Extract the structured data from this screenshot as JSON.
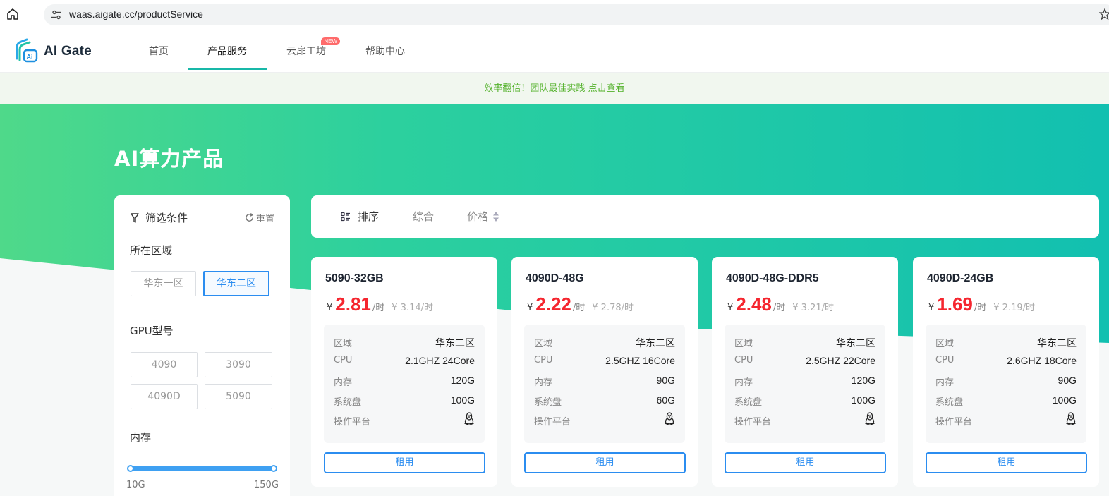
{
  "browser": {
    "url": "waas.aigate.cc/productService",
    "icons": [
      "home-icon",
      "site-settings-icon",
      "bookmark-star-icon"
    ]
  },
  "nav": {
    "logo_text": "AI Gate",
    "items": [
      {
        "label": "首页",
        "active": false
      },
      {
        "label": "产品服务",
        "active": true
      },
      {
        "label": "云扉工坊",
        "active": false,
        "badge": "NEW"
      },
      {
        "label": "帮助中心",
        "active": false
      }
    ]
  },
  "announcement": {
    "text": "效率翻倍！团队最佳实践",
    "link": "点击查看"
  },
  "hero": {
    "title": "AI算力产品"
  },
  "filter": {
    "title": "筛选条件",
    "reset": "重置",
    "region": {
      "label": "所在区域",
      "options": [
        "华东一区",
        "华东二区"
      ],
      "selected": "华东二区"
    },
    "gpu": {
      "label": "GPU型号",
      "options": [
        "4090",
        "3090",
        "4090D",
        "5090"
      ]
    },
    "memory": {
      "label": "内存",
      "min_label": "10G",
      "max_label": "150G",
      "range": [
        10,
        150
      ]
    }
  },
  "sort": {
    "label": "排序",
    "options": [
      "综合",
      "价格"
    ]
  },
  "products": [
    {
      "name": "5090-32GB",
      "currency": "¥",
      "price": "2.81",
      "unit": "/时",
      "original": "¥ 3.14/时",
      "specs": [
        {
          "k": "区域",
          "v": "华东二区"
        },
        {
          "k": "CPU",
          "v": "2.1GHZ 24Core"
        },
        {
          "k": "内存",
          "v": "120G"
        },
        {
          "k": "系统盘",
          "v": "100G"
        }
      ],
      "platform_label": "操作平台",
      "platform_icon": "linux-icon",
      "rent": "租用"
    },
    {
      "name": "4090D-48G",
      "currency": "¥",
      "price": "2.22",
      "unit": "/时",
      "original": "¥ 2.78/时",
      "specs": [
        {
          "k": "区域",
          "v": "华东二区"
        },
        {
          "k": "CPU",
          "v": "2.5GHZ 16Core"
        },
        {
          "k": "内存",
          "v": "90G"
        },
        {
          "k": "系统盘",
          "v": "60G"
        }
      ],
      "platform_label": "操作平台",
      "platform_icon": "linux-icon",
      "rent": "租用"
    },
    {
      "name": "4090D-48G-DDR5",
      "currency": "¥",
      "price": "2.48",
      "unit": "/时",
      "original": "¥ 3.21/时",
      "specs": [
        {
          "k": "区域",
          "v": "华东二区"
        },
        {
          "k": "CPU",
          "v": "2.5GHZ 22Core"
        },
        {
          "k": "内存",
          "v": "120G"
        },
        {
          "k": "系统盘",
          "v": "100G"
        }
      ],
      "platform_label": "操作平台",
      "platform_icon": "linux-icon",
      "rent": "租用"
    },
    {
      "name": "4090D-24GB",
      "currency": "¥",
      "price": "1.69",
      "unit": "/时",
      "original": "¥ 2.19/时",
      "specs": [
        {
          "k": "区域",
          "v": "华东二区"
        },
        {
          "k": "CPU",
          "v": "2.6GHZ 18Core"
        },
        {
          "k": "内存",
          "v": "90G"
        },
        {
          "k": "系统盘",
          "v": "100G"
        }
      ],
      "platform_label": "操作平台",
      "platform_icon": "linux-icon",
      "rent": "租用"
    }
  ],
  "colors": {
    "accent": "#18b8a8",
    "price": "#f5262f",
    "link_blue": "#2b8df0",
    "announce_green": "#52b12a",
    "hero_gradient_start": "#4fd98a",
    "hero_gradient_end": "#12c0b0"
  }
}
